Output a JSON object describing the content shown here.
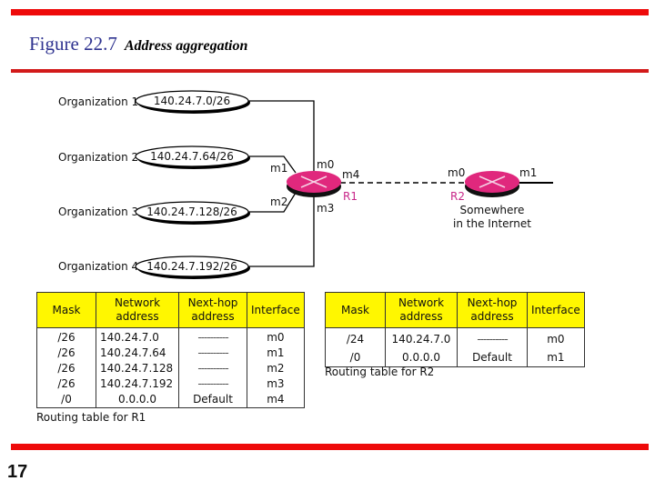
{
  "slide": {
    "figure_label": "Figure 22.7",
    "caption": "Address aggregation",
    "page_number": "17",
    "colors": {
      "accent_bar": "#ee0a0a",
      "figure_label": "#2f3390",
      "router": "#e0287d",
      "table_header": "#fff700",
      "router_label": "#c8288a"
    }
  },
  "diagram": {
    "organizations": [
      {
        "name": "Organization 1",
        "block": "140.24.7.0/26"
      },
      {
        "name": "Organization 2",
        "block": "140.24.7.64/26"
      },
      {
        "name": "Organization 3",
        "block": "140.24.7.128/26"
      },
      {
        "name": "Organization 4",
        "block": "140.24.7.192/26"
      }
    ],
    "router1": {
      "name": "R1",
      "interfaces": [
        "m0",
        "m1",
        "m2",
        "m3",
        "m4"
      ]
    },
    "router2": {
      "name": "R2",
      "interfaces": [
        "m0",
        "m1"
      ],
      "location": "Somewhere",
      "location2": "in the Internet"
    }
  },
  "tables": {
    "r1": {
      "caption": "Routing table for R1",
      "headers": {
        "mask": "Mask",
        "net1": "Network",
        "net2": "address",
        "hop1": "Next-hop",
        "hop2": "address",
        "iface": "Interface"
      },
      "rows": [
        {
          "mask": "/26",
          "network": "140.24.7.0",
          "next_hop": "----------",
          "interface": "m0"
        },
        {
          "mask": "/26",
          "network": "140.24.7.64",
          "next_hop": "----------",
          "interface": "m1"
        },
        {
          "mask": "/26",
          "network": "140.24.7.128",
          "next_hop": "----------",
          "interface": "m2"
        },
        {
          "mask": "/26",
          "network": "140.24.7.192",
          "next_hop": "----------",
          "interface": "m3"
        },
        {
          "mask": "/0",
          "network": "0.0.0.0",
          "next_hop": "Default",
          "interface": "m4"
        }
      ]
    },
    "r2": {
      "caption": "Routing table for R2",
      "headers": {
        "mask": "Mask",
        "net1": "Network",
        "net2": "address",
        "hop1": "Next-hop",
        "hop2": "address",
        "iface": "Interface"
      },
      "rows": [
        {
          "mask": "/24",
          "network": "140.24.7.0",
          "next_hop": "----------",
          "interface": "m0"
        },
        {
          "mask": "/0",
          "network": "0.0.0.0",
          "next_hop": "Default",
          "interface": "m1"
        }
      ]
    }
  }
}
